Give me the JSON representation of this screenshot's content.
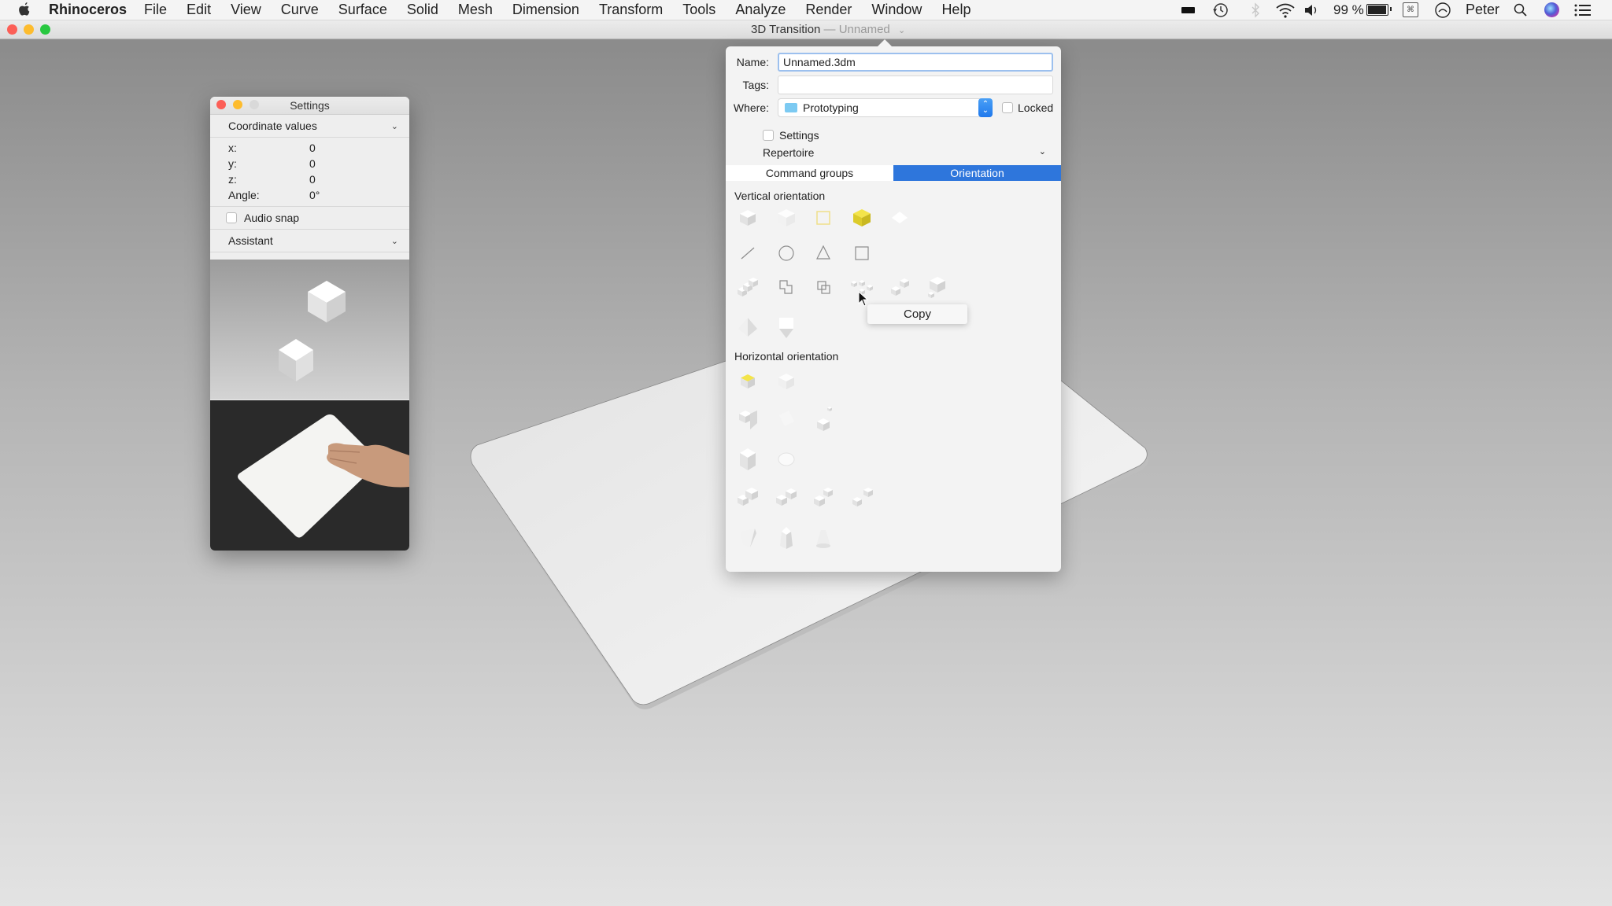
{
  "menubar": {
    "app_name": "Rhinoceros",
    "menus": [
      "File",
      "Edit",
      "View",
      "Curve",
      "Surface",
      "Solid",
      "Mesh",
      "Dimension",
      "Transform",
      "Tools",
      "Analyze",
      "Render",
      "Window",
      "Help"
    ],
    "status": {
      "battery_percent": "99 %",
      "user": "Peter",
      "icons": [
        "display-icon",
        "time-machine-icon",
        "bluetooth-icon",
        "wifi-icon",
        "volume-icon",
        "battery-icon",
        "keyboard-viewer-icon",
        "notification-icon",
        "spotlight-icon",
        "siri-icon",
        "control-list-icon"
      ]
    }
  },
  "window": {
    "document_title": "3D Transition",
    "document_separator": "—",
    "document_subtitle": "Unnamed"
  },
  "settings_panel": {
    "title": "Settings",
    "coordinate_section": "Coordinate values",
    "coordinates": [
      {
        "label": "x:",
        "value": "0"
      },
      {
        "label": "y:",
        "value": "0"
      },
      {
        "label": "z:",
        "value": "0"
      },
      {
        "label": "Angle:",
        "value": "0°"
      }
    ],
    "audio_snap_label": "Audio snap",
    "audio_snap_checked": false,
    "assistant_section": "Assistant"
  },
  "info_panel": {
    "name_label": "Name:",
    "name_value": "Unnamed.3dm",
    "tags_label": "Tags:",
    "tags_value": "",
    "where_label": "Where:",
    "where_value": "Prototyping",
    "locked_label": "Locked",
    "locked_checked": false,
    "settings_label": "Settings",
    "settings_checked": false,
    "repertoire_label": "Repertoire",
    "tabs": [
      {
        "label": "Command groups",
        "active": false
      },
      {
        "label": "Orientation",
        "active": true
      }
    ],
    "vertical_header": "Vertical orientation",
    "vertical_icons": [
      [
        "cube-icon",
        "cube-front-icon",
        "square-outline-yellow-icon",
        "cube-yellow-icon",
        "flat-tile-icon"
      ],
      [
        "line-icon",
        "circle-icon",
        "triangle-icon",
        "square-icon"
      ],
      [
        "cube-row-icon",
        "union-icon",
        "intersect-icon",
        "scatter-cubes-icon",
        "two-cubes-icon",
        "stacked-cubes-icon"
      ],
      [
        "pyramid-icon",
        "prism-icon"
      ]
    ],
    "horizontal_header": "Horizontal orientation",
    "horizontal_icons": [
      [
        "tile-yellow-icon",
        "cube-soft-icon"
      ],
      [
        "cube-split-icon",
        "cube-tilt-icon",
        "cube-small-pair-icon"
      ],
      [
        "tall-cube-icon",
        "sphere-icon"
      ],
      [
        "cube-pair-icon",
        "cube-pair-linked-icon",
        "cube-cross-icon",
        "cube-diagonal-icon"
      ],
      [
        "wedge-icon",
        "tapered-box-icon",
        "cone-icon"
      ]
    ]
  },
  "context_menu": {
    "items": [
      "Copy"
    ]
  },
  "colors": {
    "accent": "#2e76dc",
    "highlight_yellow": "#f2e03a",
    "close": "#fc5f57",
    "minimize": "#fdbc2e",
    "zoom": "#28c840"
  }
}
